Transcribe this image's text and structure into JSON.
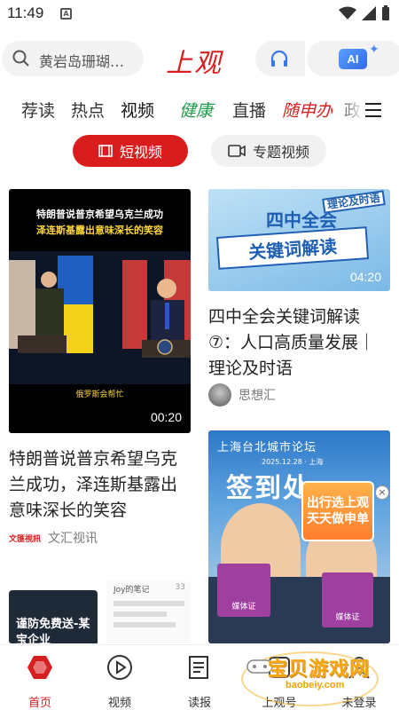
{
  "status_bar": {
    "time": "11:49"
  },
  "header": {
    "search_placeholder": "黄岩岛珊瑚…",
    "logo": "上观",
    "ai_badge": "AI"
  },
  "channels": [
    {
      "label": "荐读"
    },
    {
      "label": "热点"
    },
    {
      "label": "视频"
    },
    {
      "label": "健康"
    },
    {
      "label": "直播"
    },
    {
      "label": "随申办"
    },
    {
      "label": "政"
    }
  ],
  "subtabs": {
    "short_video": "短视频",
    "topic_video": "专题视频"
  },
  "cards": {
    "left1": {
      "overlay_line1": "特朗普说普京希望乌克兰成功",
      "overlay_line2": "泽连斯基露出意味深长的笑容",
      "overlay_caption": "俄罗斯会帮忙",
      "duration": "00:20",
      "title": "特朗普说普京希望乌克兰成功，泽连斯基露出意味深长的笑容",
      "source": "文汇视讯",
      "source_logo": "文匯視訊"
    },
    "right1": {
      "overlay_top": "四中全会",
      "overlay_main": "关键词解读",
      "corner_badge": "理论及时语",
      "duration": "04:20",
      "title": "四中全会关键词解读⑦：人口高质量发展｜理论及时语",
      "source": "思想汇"
    },
    "right2": {
      "overlay_header": "上海台北城市论坛",
      "overlay_date": "2025.12.28 · 上海",
      "overlay_sign": "签到处",
      "ad_text": "出行选上观 天天做申单",
      "badge_text": "媒体证"
    },
    "left3": {
      "overlay_text": "谨防免费送-某宝企业",
      "chat_meta": "Joy的笔记",
      "chat_likes": "33"
    }
  },
  "bottom_nav": [
    {
      "label": "首页",
      "icon": "home-icon"
    },
    {
      "label": "视频",
      "icon": "video-play-icon"
    },
    {
      "label": "读报",
      "icon": "newspaper-icon"
    },
    {
      "label": "上观号",
      "icon": "account-icon"
    },
    {
      "label": "未登录",
      "icon": "user-icon"
    }
  ],
  "watermark": {
    "text": "宝贝游戏网",
    "url": "baobeiy.com"
  },
  "colors": {
    "brand_red": "#d71f1f",
    "health_green": "#1e9b4a"
  }
}
